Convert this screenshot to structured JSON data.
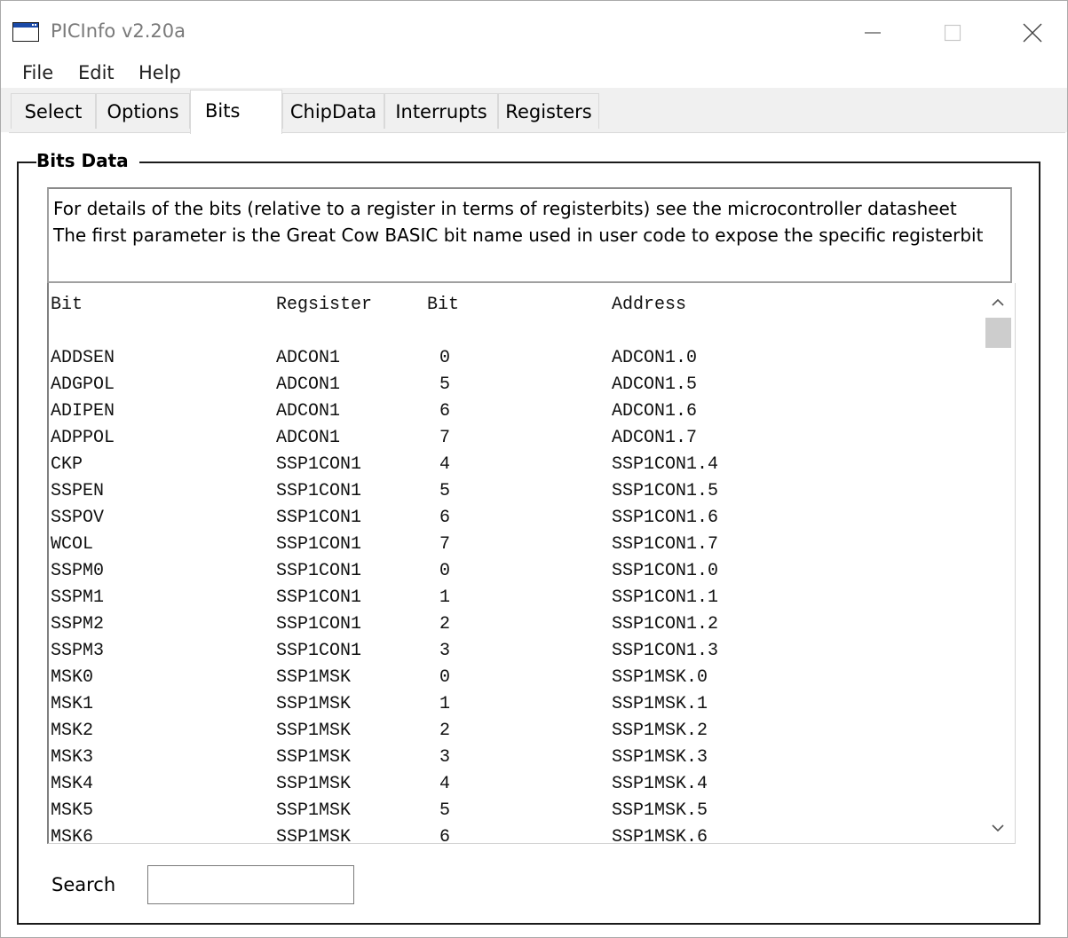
{
  "window": {
    "title": "PICInfo v2.20a"
  },
  "menu": {
    "items": [
      "File",
      "Edit",
      "Help"
    ]
  },
  "tabs": [
    "Select",
    "Options",
    "Bits",
    "ChipData",
    "Interrupts",
    "Registers"
  ],
  "active_tab": "Bits",
  "group": {
    "title": "Bits Data"
  },
  "info": {
    "line1": "For details of the bits (relative to a register in terms of registerbits) see the microcontroller datasheet",
    "line2": "The first parameter is the Great Cow BASIC bit name used in user code to expose the specific registerbit"
  },
  "list": {
    "headers": [
      "Bit",
      "Regsister",
      "Bit",
      "Address"
    ],
    "rows": [
      [
        "ADDSEN",
        "ADCON1",
        "0",
        "ADCON1.0"
      ],
      [
        "ADGPOL",
        "ADCON1",
        "5",
        "ADCON1.5"
      ],
      [
        "ADIPEN",
        "ADCON1",
        "6",
        "ADCON1.6"
      ],
      [
        "ADPPOL",
        "ADCON1",
        "7",
        "ADCON1.7"
      ],
      [
        "CKP",
        "SSP1CON1",
        "4",
        "SSP1CON1.4"
      ],
      [
        "SSPEN",
        "SSP1CON1",
        "5",
        "SSP1CON1.5"
      ],
      [
        "SSPOV",
        "SSP1CON1",
        "6",
        "SSP1CON1.6"
      ],
      [
        "WCOL",
        "SSP1CON1",
        "7",
        "SSP1CON1.7"
      ],
      [
        "SSPM0",
        "SSP1CON1",
        "0",
        "SSP1CON1.0"
      ],
      [
        "SSPM1",
        "SSP1CON1",
        "1",
        "SSP1CON1.1"
      ],
      [
        "SSPM2",
        "SSP1CON1",
        "2",
        "SSP1CON1.2"
      ],
      [
        "SSPM3",
        "SSP1CON1",
        "3",
        "SSP1CON1.3"
      ],
      [
        "MSK0",
        "SSP1MSK",
        "0",
        "SSP1MSK.0"
      ],
      [
        "MSK1",
        "SSP1MSK",
        "1",
        "SSP1MSK.1"
      ],
      [
        "MSK2",
        "SSP1MSK",
        "2",
        "SSP1MSK.2"
      ],
      [
        "MSK3",
        "SSP1MSK",
        "3",
        "SSP1MSK.3"
      ],
      [
        "MSK4",
        "SSP1MSK",
        "4",
        "SSP1MSK.4"
      ],
      [
        "MSK5",
        "SSP1MSK",
        "5",
        "SSP1MSK.5"
      ],
      [
        "MSK6",
        "SSP1MSK",
        "6",
        "SSP1MSK.6"
      ]
    ]
  },
  "search": {
    "label": "Search",
    "value": ""
  },
  "icons": {
    "app": "window-app-icon",
    "minimize": "minimize-icon",
    "maximize": "maximize-icon",
    "close": "close-icon",
    "scroll_up": "chevron-up-icon",
    "scroll_down": "chevron-down-icon"
  }
}
